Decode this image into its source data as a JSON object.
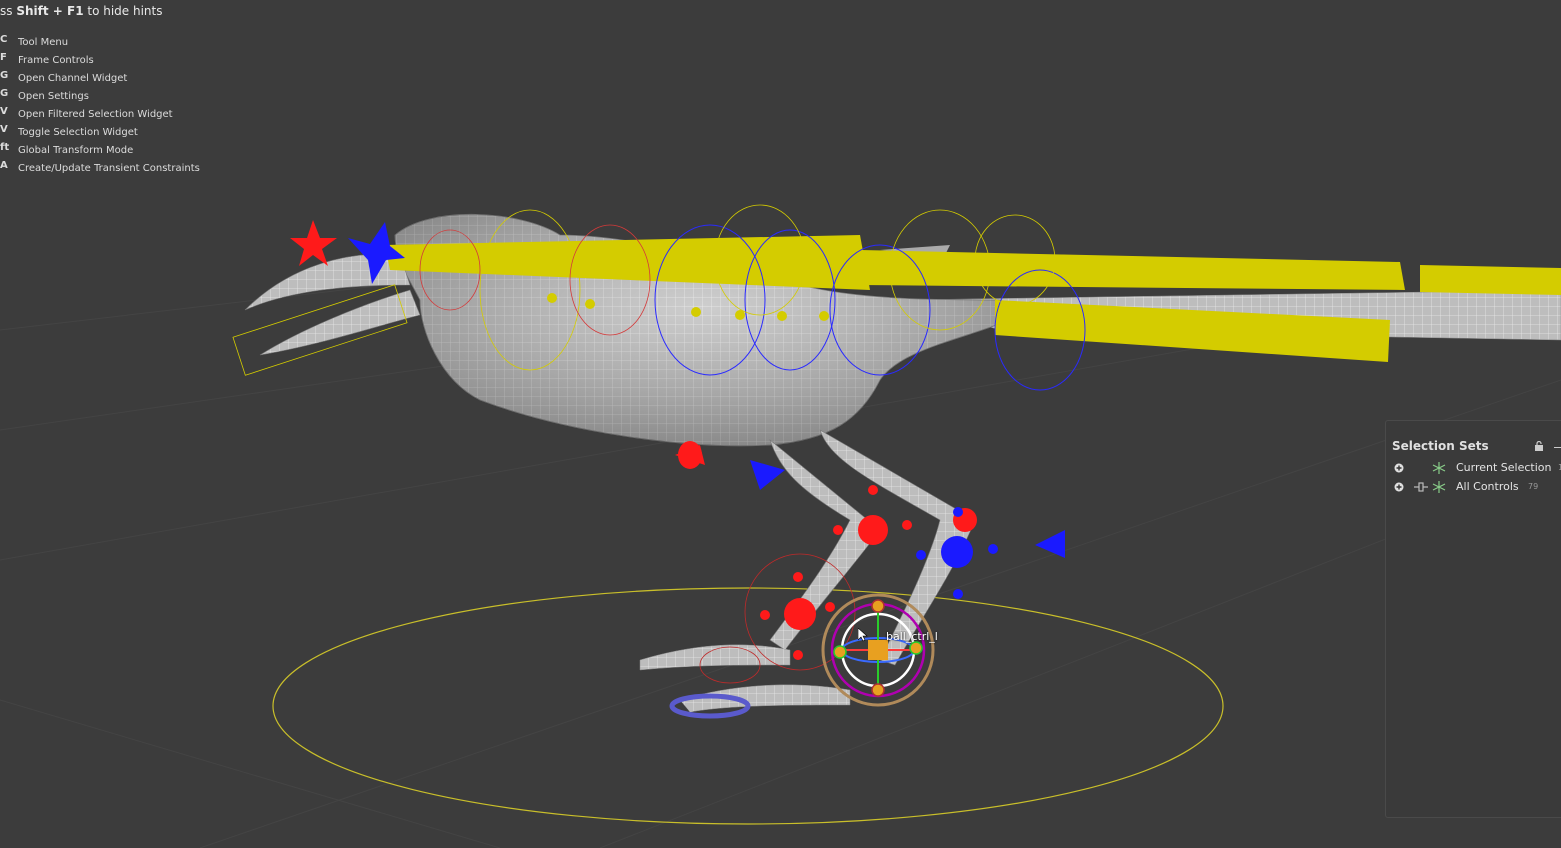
{
  "hints": {
    "top_prefix": "ss ",
    "top_key": "Shift + F1",
    "top_suffix": " to hide hints",
    "items": [
      {
        "key": "C",
        "label": "Tool Menu"
      },
      {
        "key": "F",
        "label": "Frame Controls"
      },
      {
        "key": "G",
        "label": "Open Channel Widget"
      },
      {
        "key": "G",
        "label": "Open Settings"
      },
      {
        "key": "V",
        "label": "Open Filtered Selection Widget"
      },
      {
        "key": "V",
        "label": "Toggle Selection Widget"
      },
      {
        "key": "ft",
        "label": "Global Transform Mode"
      },
      {
        "key": "A",
        "label": "Create/Update Transient Constraints"
      }
    ]
  },
  "viewport": {
    "selected_control": "ball_ctrl_l",
    "colors": {
      "background": "#3c3c3c",
      "mesh": "#c8c8c8",
      "yellow_ctrl": "#d4cc00",
      "blue_ctrl": "#1a1aff",
      "red_ctrl": "#ff1a1a"
    }
  },
  "selection_sets": {
    "title": "Selection Sets",
    "lock_icon": "lock-icon",
    "sets": [
      {
        "label": "Current Selection",
        "count": "1"
      },
      {
        "label": "All Controls",
        "count": "79"
      }
    ]
  }
}
